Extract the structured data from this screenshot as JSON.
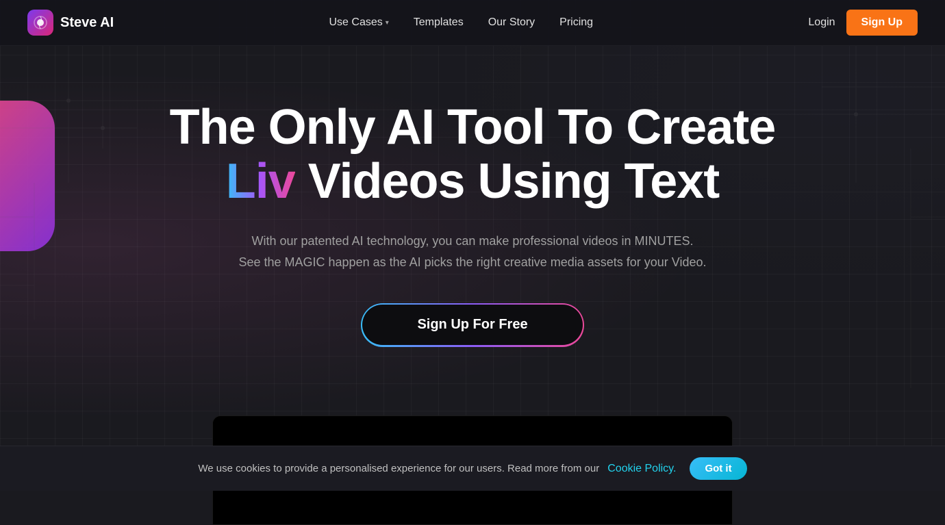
{
  "navbar": {
    "logo_text": "Steve AI",
    "nav_items": [
      {
        "label": "Use Cases",
        "has_dropdown": true
      },
      {
        "label": "Templates",
        "has_dropdown": false
      },
      {
        "label": "Our Story",
        "has_dropdown": false
      },
      {
        "label": "Pricing",
        "has_dropdown": false
      }
    ],
    "login_label": "Login",
    "signup_label": "Sign Up"
  },
  "hero": {
    "title_part1": "The Only AI Tool To Create ",
    "title_liv": "Liv",
    "title_part2": " Videos Using Text",
    "subtitle_line1": "With our patented AI technology, you can make professional videos in MINUTES.",
    "subtitle_line2": "See the MAGIC happen as the AI picks the right creative media assets for your Video.",
    "cta_label": "Sign Up For Free"
  },
  "cookie": {
    "text": "We use cookies to provide a personalised experience for our users. Read more from our ",
    "link_text": "Cookie Policy.",
    "button_label": "Got it"
  }
}
